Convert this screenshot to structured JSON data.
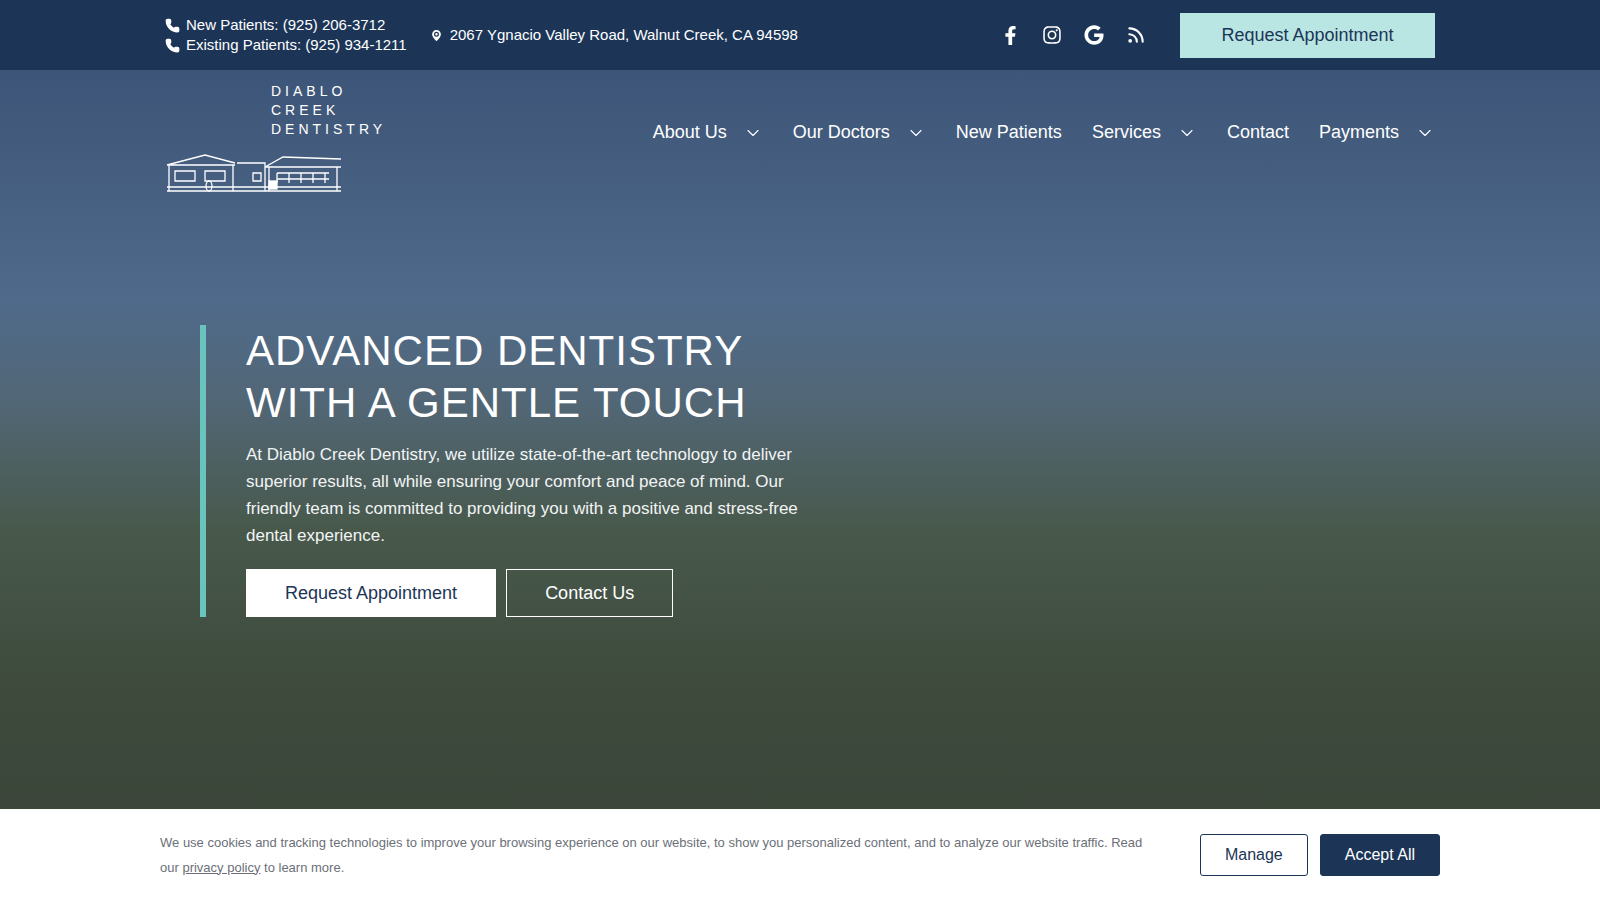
{
  "topbar": {
    "phones": [
      {
        "label": "New Patients: (925) 206-3712"
      },
      {
        "label": "Existing Patients: (925) 934-1211"
      }
    ],
    "address": "2067 Ygnacio Valley Road, Walnut Creek, CA 94598",
    "request_button": "Request Appointment"
  },
  "logo": {
    "lines": [
      "DIABLO",
      "CREEK",
      "DENTISTRY"
    ]
  },
  "nav": [
    {
      "label": "About Us",
      "dropdown": true
    },
    {
      "label": "Our Doctors",
      "dropdown": true
    },
    {
      "label": "New Patients",
      "dropdown": false
    },
    {
      "label": "Services",
      "dropdown": true
    },
    {
      "label": "Contact",
      "dropdown": false
    },
    {
      "label": "Payments",
      "dropdown": true
    }
  ],
  "hero": {
    "title_lines": [
      "ADVANCED DENTISTRY",
      "WITH A GENTLE TOUCH"
    ],
    "text": "At Diablo Creek Dentistry, we utilize state-of-the-art technology to deliver superior results, all while ensuring your comfort and peace of mind. Our friendly team is committed to providing you with a positive and stress-free dental experience.",
    "buttons": [
      {
        "label": "Request Appointment",
        "kind": "solid"
      },
      {
        "label": "Contact Us",
        "kind": "outline"
      }
    ]
  },
  "cookie": {
    "text_before": "We use cookies and tracking technologies to improve your browsing experience on our website, to show you personalized content, and to analyze our website traffic. Read our ",
    "link": "privacy policy",
    "text_after": " to learn more.",
    "buttons": [
      {
        "label": "Manage",
        "kind": "outline"
      },
      {
        "label": "Accept All",
        "kind": "solid"
      }
    ]
  }
}
